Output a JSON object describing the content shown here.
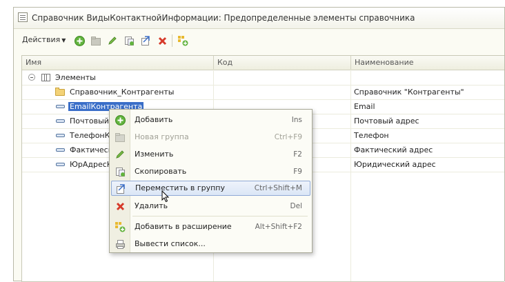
{
  "window": {
    "title": "Справочник ВидыКонтактнойИнформации: Предопределенные элементы справочника"
  },
  "toolbar": {
    "actions_label": "Действия",
    "buttons": [
      "add-icon",
      "add-group-icon",
      "edit-icon",
      "copy-icon",
      "move-to-group-icon",
      "delete-icon",
      "add-to-extension-icon"
    ]
  },
  "grid": {
    "columns": [
      "Имя",
      "Код",
      "Наименование"
    ],
    "root": {
      "name": "Элементы"
    },
    "rows": [
      {
        "name": "Справочник_Контрагенты",
        "code": "",
        "title": "Справочник \"Контрагенты\"",
        "type": "folder"
      },
      {
        "name": "EmailКонтрагента",
        "code": "",
        "title": "Email",
        "type": "element",
        "selected": true
      },
      {
        "name": "ПочтовыйА",
        "code": "",
        "title": "Почтовый адрес",
        "type": "element"
      },
      {
        "name": "ТелефонК",
        "code": "",
        "title": "Телефон",
        "type": "element"
      },
      {
        "name": "Фактическ",
        "code": "",
        "title": "Фактический адрес",
        "type": "element"
      },
      {
        "name": "ЮрАдресК",
        "code": "",
        "title": "Юридический адрес",
        "type": "element"
      }
    ]
  },
  "context_menu": {
    "items": [
      {
        "label": "Добавить",
        "shortcut": "Ins",
        "icon": "add-icon",
        "disabled": false
      },
      {
        "label": "Новая группа",
        "shortcut": "Ctrl+F9",
        "icon": "add-group-icon",
        "disabled": true
      },
      {
        "label": "Изменить",
        "shortcut": "F2",
        "icon": "edit-icon",
        "disabled": false
      },
      {
        "label": "Скопировать",
        "shortcut": "F9",
        "icon": "copy-icon",
        "disabled": false
      },
      {
        "label": "Переместить в группу",
        "shortcut": "Ctrl+Shift+M",
        "icon": "move-to-group-icon",
        "disabled": false,
        "highlighted": true
      },
      {
        "label": "Удалить",
        "shortcut": "Del",
        "icon": "delete-icon",
        "disabled": false
      },
      {
        "label": "Добавить в расширение",
        "shortcut": "Alt+Shift+F2",
        "icon": "add-to-extension-icon",
        "disabled": false
      },
      {
        "label": "Вывести список...",
        "shortcut": "",
        "icon": "print-list-icon",
        "disabled": false
      }
    ]
  },
  "colors": {
    "selection": "#3a6ec8",
    "menu_highlight": "#dbe6f6",
    "window_bg": "#fbfbf3"
  }
}
